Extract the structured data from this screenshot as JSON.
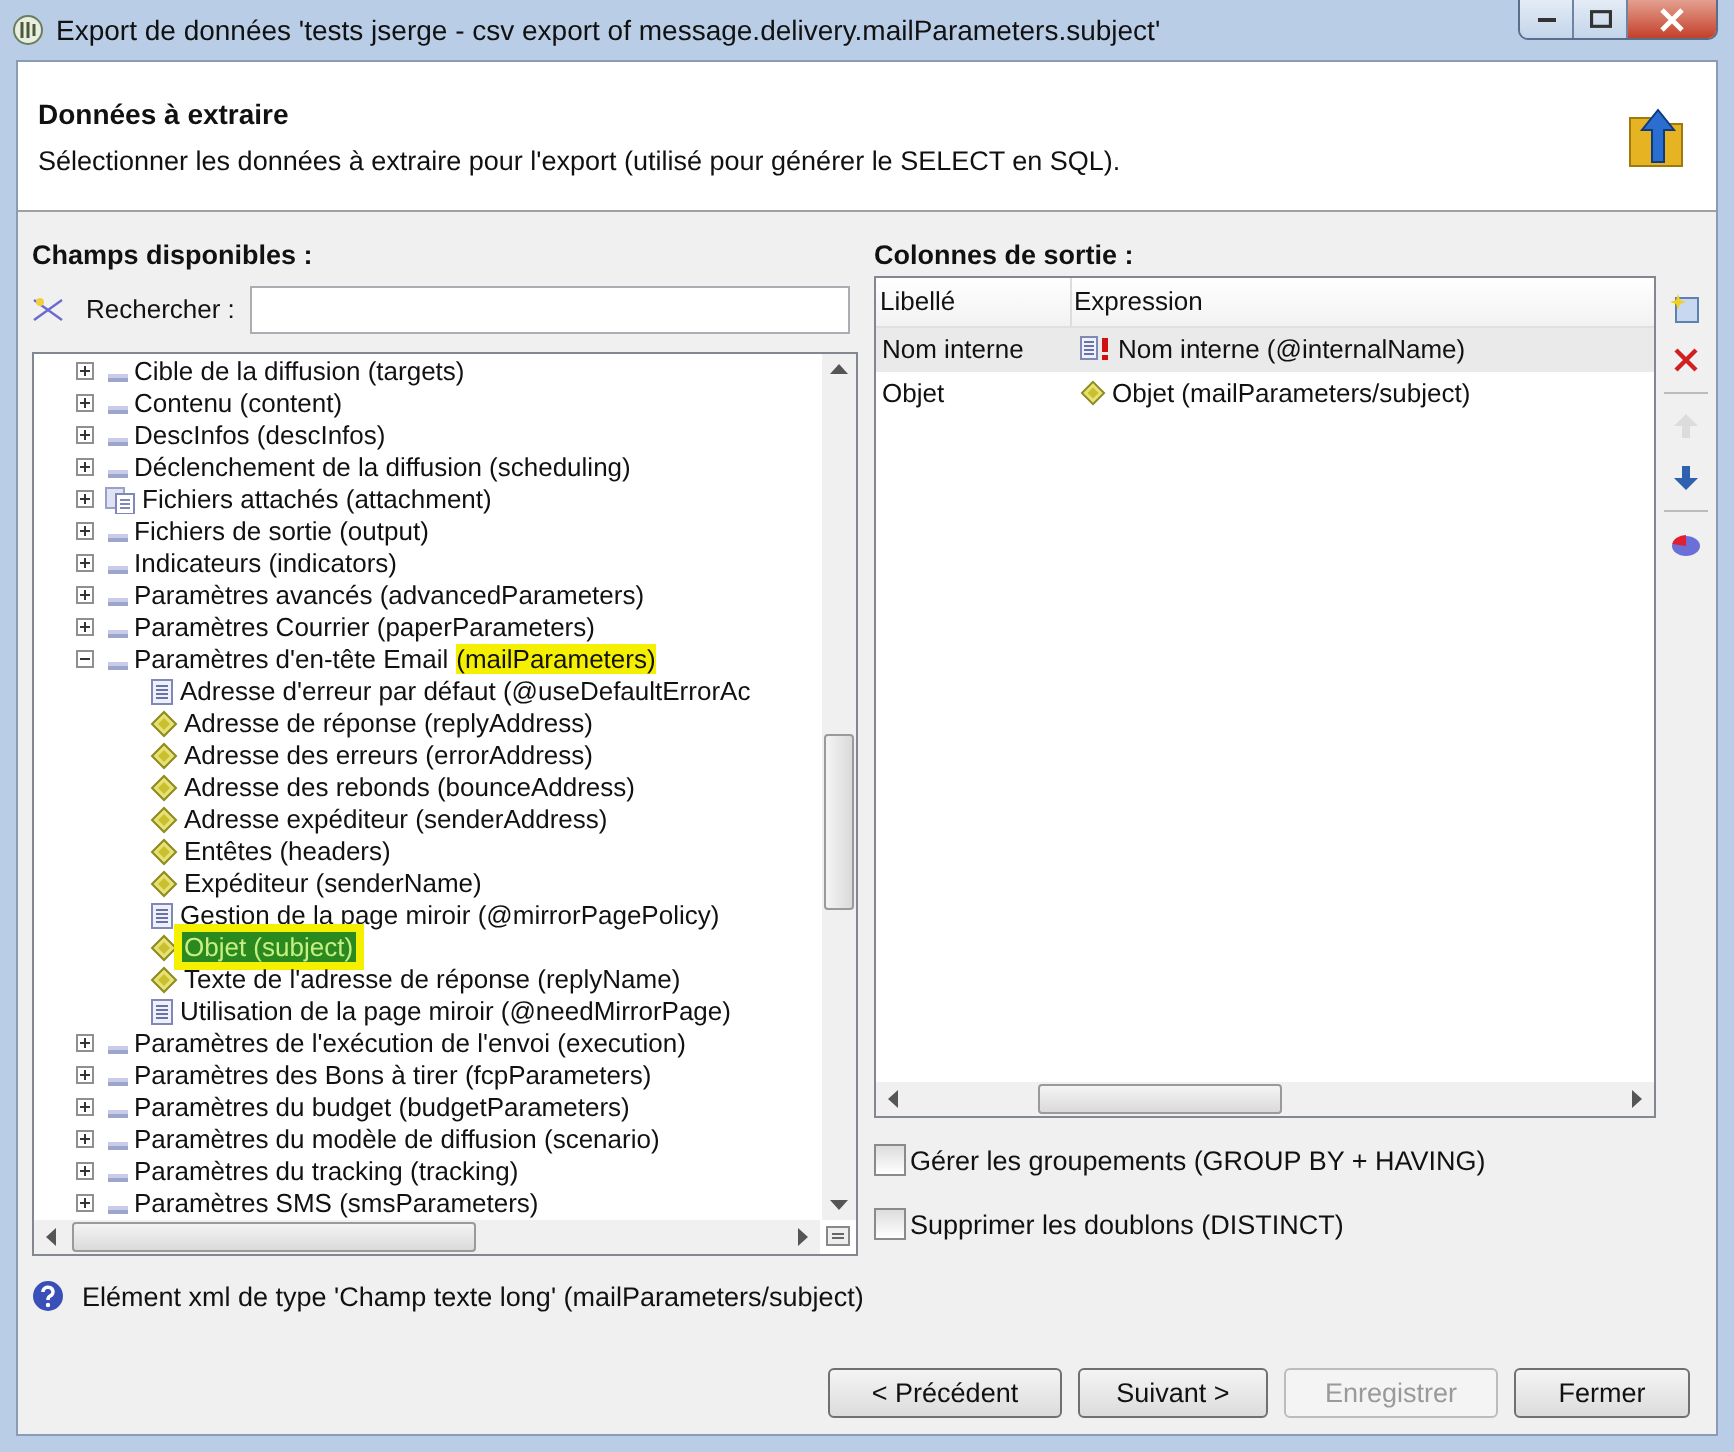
{
  "window": {
    "title": "Export de données 'tests jserge - csv export of message.delivery.mailParameters.subject'"
  },
  "header": {
    "title": "Données à extraire",
    "description": "Sélectionner les données à extraire pour l'export (utilisé pour générer le SELECT en SQL)."
  },
  "available": {
    "title": "Champs disponibles :",
    "search_label": "Rechercher :",
    "tree": [
      {
        "label": "Cible de la diffusion (targets)",
        "kind": "folder",
        "expanded": false,
        "selected": false
      },
      {
        "label": "Contenu (content)",
        "kind": "folder",
        "expanded": false,
        "selected": false
      },
      {
        "label": "DescInfos (descInfos)",
        "kind": "folder",
        "expanded": false,
        "selected": false
      },
      {
        "label": "Déclenchement de la diffusion (scheduling)",
        "kind": "folder",
        "expanded": false,
        "selected": false
      },
      {
        "label": "Fichiers attachés (attachment)",
        "kind": "collection",
        "expanded": false,
        "selected": false
      },
      {
        "label": "Fichiers de sortie (output)",
        "kind": "folder",
        "expanded": false,
        "selected": false
      },
      {
        "label": "Indicateurs (indicators)",
        "kind": "folder",
        "expanded": false,
        "selected": false
      },
      {
        "label": "Paramètres avancés (advancedParameters)",
        "kind": "folder",
        "expanded": false,
        "selected": false
      },
      {
        "label": "Paramètres Courrier (paperParameters)",
        "kind": "folder",
        "expanded": false,
        "selected": false
      },
      {
        "label": "Paramètres d'en-tête Email",
        "highlight": "(mailParameters)",
        "kind": "folder",
        "expanded": true,
        "selected": false,
        "children": [
          {
            "label": "Adresse d'erreur par défaut (@useDefaultErrorAc",
            "kind": "attribute",
            "selected": false
          },
          {
            "label": "Adresse de réponse (replyAddress)",
            "kind": "element",
            "selected": false
          },
          {
            "label": "Adresse des erreurs (errorAddress)",
            "kind": "element",
            "selected": false
          },
          {
            "label": "Adresse des rebonds (bounceAddress)",
            "kind": "element",
            "selected": false
          },
          {
            "label": "Adresse expéditeur (senderAddress)",
            "kind": "element",
            "selected": false
          },
          {
            "label": "Entêtes (headers)",
            "kind": "element",
            "selected": false
          },
          {
            "label": "Expéditeur (senderName)",
            "kind": "element",
            "selected": false
          },
          {
            "label": "Gestion de la page miroir (@mirrorPagePolicy)",
            "kind": "attribute",
            "selected": false
          },
          {
            "label": "Objet (subject)",
            "kind": "element",
            "selected": true
          },
          {
            "label": "Texte de l'adresse de réponse (replyName)",
            "kind": "element",
            "selected": false
          },
          {
            "label": "Utilisation de la page miroir (@needMirrorPage)",
            "kind": "attribute",
            "selected": false
          }
        ]
      },
      {
        "label": "Paramètres de l'exécution de l'envoi (execution)",
        "kind": "folder",
        "expanded": false,
        "selected": false
      },
      {
        "label": "Paramètres des Bons à tirer (fcpParameters)",
        "kind": "folder",
        "expanded": false,
        "selected": false
      },
      {
        "label": "Paramètres du budget (budgetParameters)",
        "kind": "folder",
        "expanded": false,
        "selected": false
      },
      {
        "label": "Paramètres du modèle de diffusion (scenario)",
        "kind": "folder",
        "expanded": false,
        "selected": false
      },
      {
        "label": "Paramètres du tracking (tracking)",
        "kind": "folder",
        "expanded": false,
        "selected": false
      },
      {
        "label": "Paramètres SMS (smsParameters)",
        "kind": "folder",
        "expanded": false,
        "selected": false
      }
    ]
  },
  "output": {
    "title": "Colonnes de sortie :",
    "columns": [
      "Libellé",
      "Expression"
    ],
    "rows": [
      {
        "label": "Nom interne",
        "expression": "Nom interne (@internalName)",
        "kind": "required-attribute",
        "selected": true
      },
      {
        "label": "Objet",
        "expression": "Objet (mailParameters/subject)",
        "kind": "element",
        "selected": false
      }
    ],
    "tools": [
      {
        "kind": "add",
        "disabled": false
      },
      {
        "kind": "delete",
        "disabled": false
      },
      {
        "kind": "up",
        "disabled": true
      },
      {
        "kind": "down",
        "disabled": false
      },
      {
        "kind": "chart",
        "disabled": false
      }
    ],
    "options": [
      {
        "label": "Gérer les groupements (GROUP BY + HAVING)",
        "checked": false
      },
      {
        "label": "Supprimer les doublons (DISTINCT)",
        "checked": false
      }
    ]
  },
  "info": "Elément xml de type 'Champ texte long' (mailParameters/subject)",
  "buttons": [
    {
      "label": "< Précédent",
      "disabled": false
    },
    {
      "label": "Suivant >",
      "disabled": false
    },
    {
      "label": "Enregistrer",
      "disabled": true
    },
    {
      "label": "Fermer",
      "disabled": false
    }
  ]
}
